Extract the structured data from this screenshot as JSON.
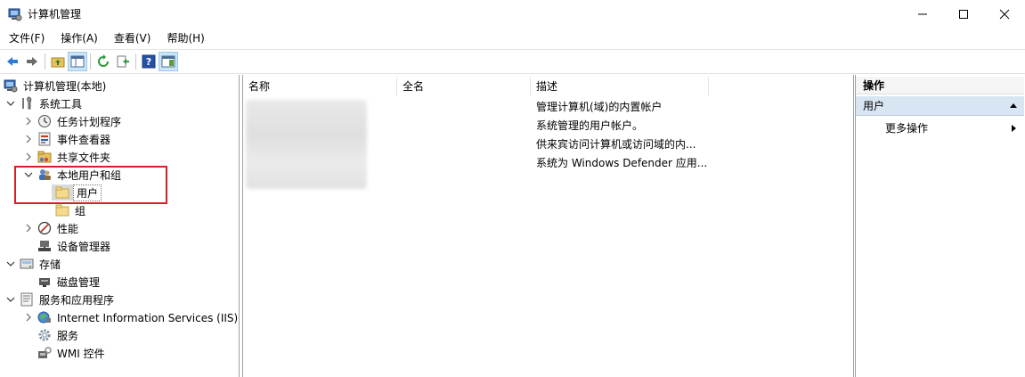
{
  "window": {
    "title": "计算机管理"
  },
  "menu": [
    "文件(F)",
    "操作(A)",
    "查看(V)",
    "帮助(H)"
  ],
  "tree": {
    "root": "计算机管理(本地)",
    "system_tools": "系统工具",
    "task_scheduler": "任务计划程序",
    "event_viewer": "事件查看器",
    "shared_folders": "共享文件夹",
    "local_users_groups": "本地用户和组",
    "users": "用户",
    "groups": "组",
    "performance": "性能",
    "device_manager": "设备管理器",
    "storage": "存储",
    "disk_management": "磁盘管理",
    "services_apps": "服务和应用程序",
    "iis": "Internet Information Services (IIS)管",
    "services": "服务",
    "wmi": "WMI 控件"
  },
  "list": {
    "columns": [
      "名称",
      "全名",
      "描述"
    ],
    "rows": [
      {
        "description": "管理计算机(域)的内置帐户"
      },
      {
        "description": "系统管理的用户帐户。"
      },
      {
        "description": "供来宾访问计算机或访问域的内..."
      },
      {
        "description": "系统为 Windows Defender 应用..."
      }
    ]
  },
  "actions": {
    "header": "操作",
    "section": "用户",
    "more": "更多操作"
  },
  "colors": {
    "highlight": "#d32027",
    "selection": "#d9d9d9",
    "action_section": "#d8e6f3"
  }
}
